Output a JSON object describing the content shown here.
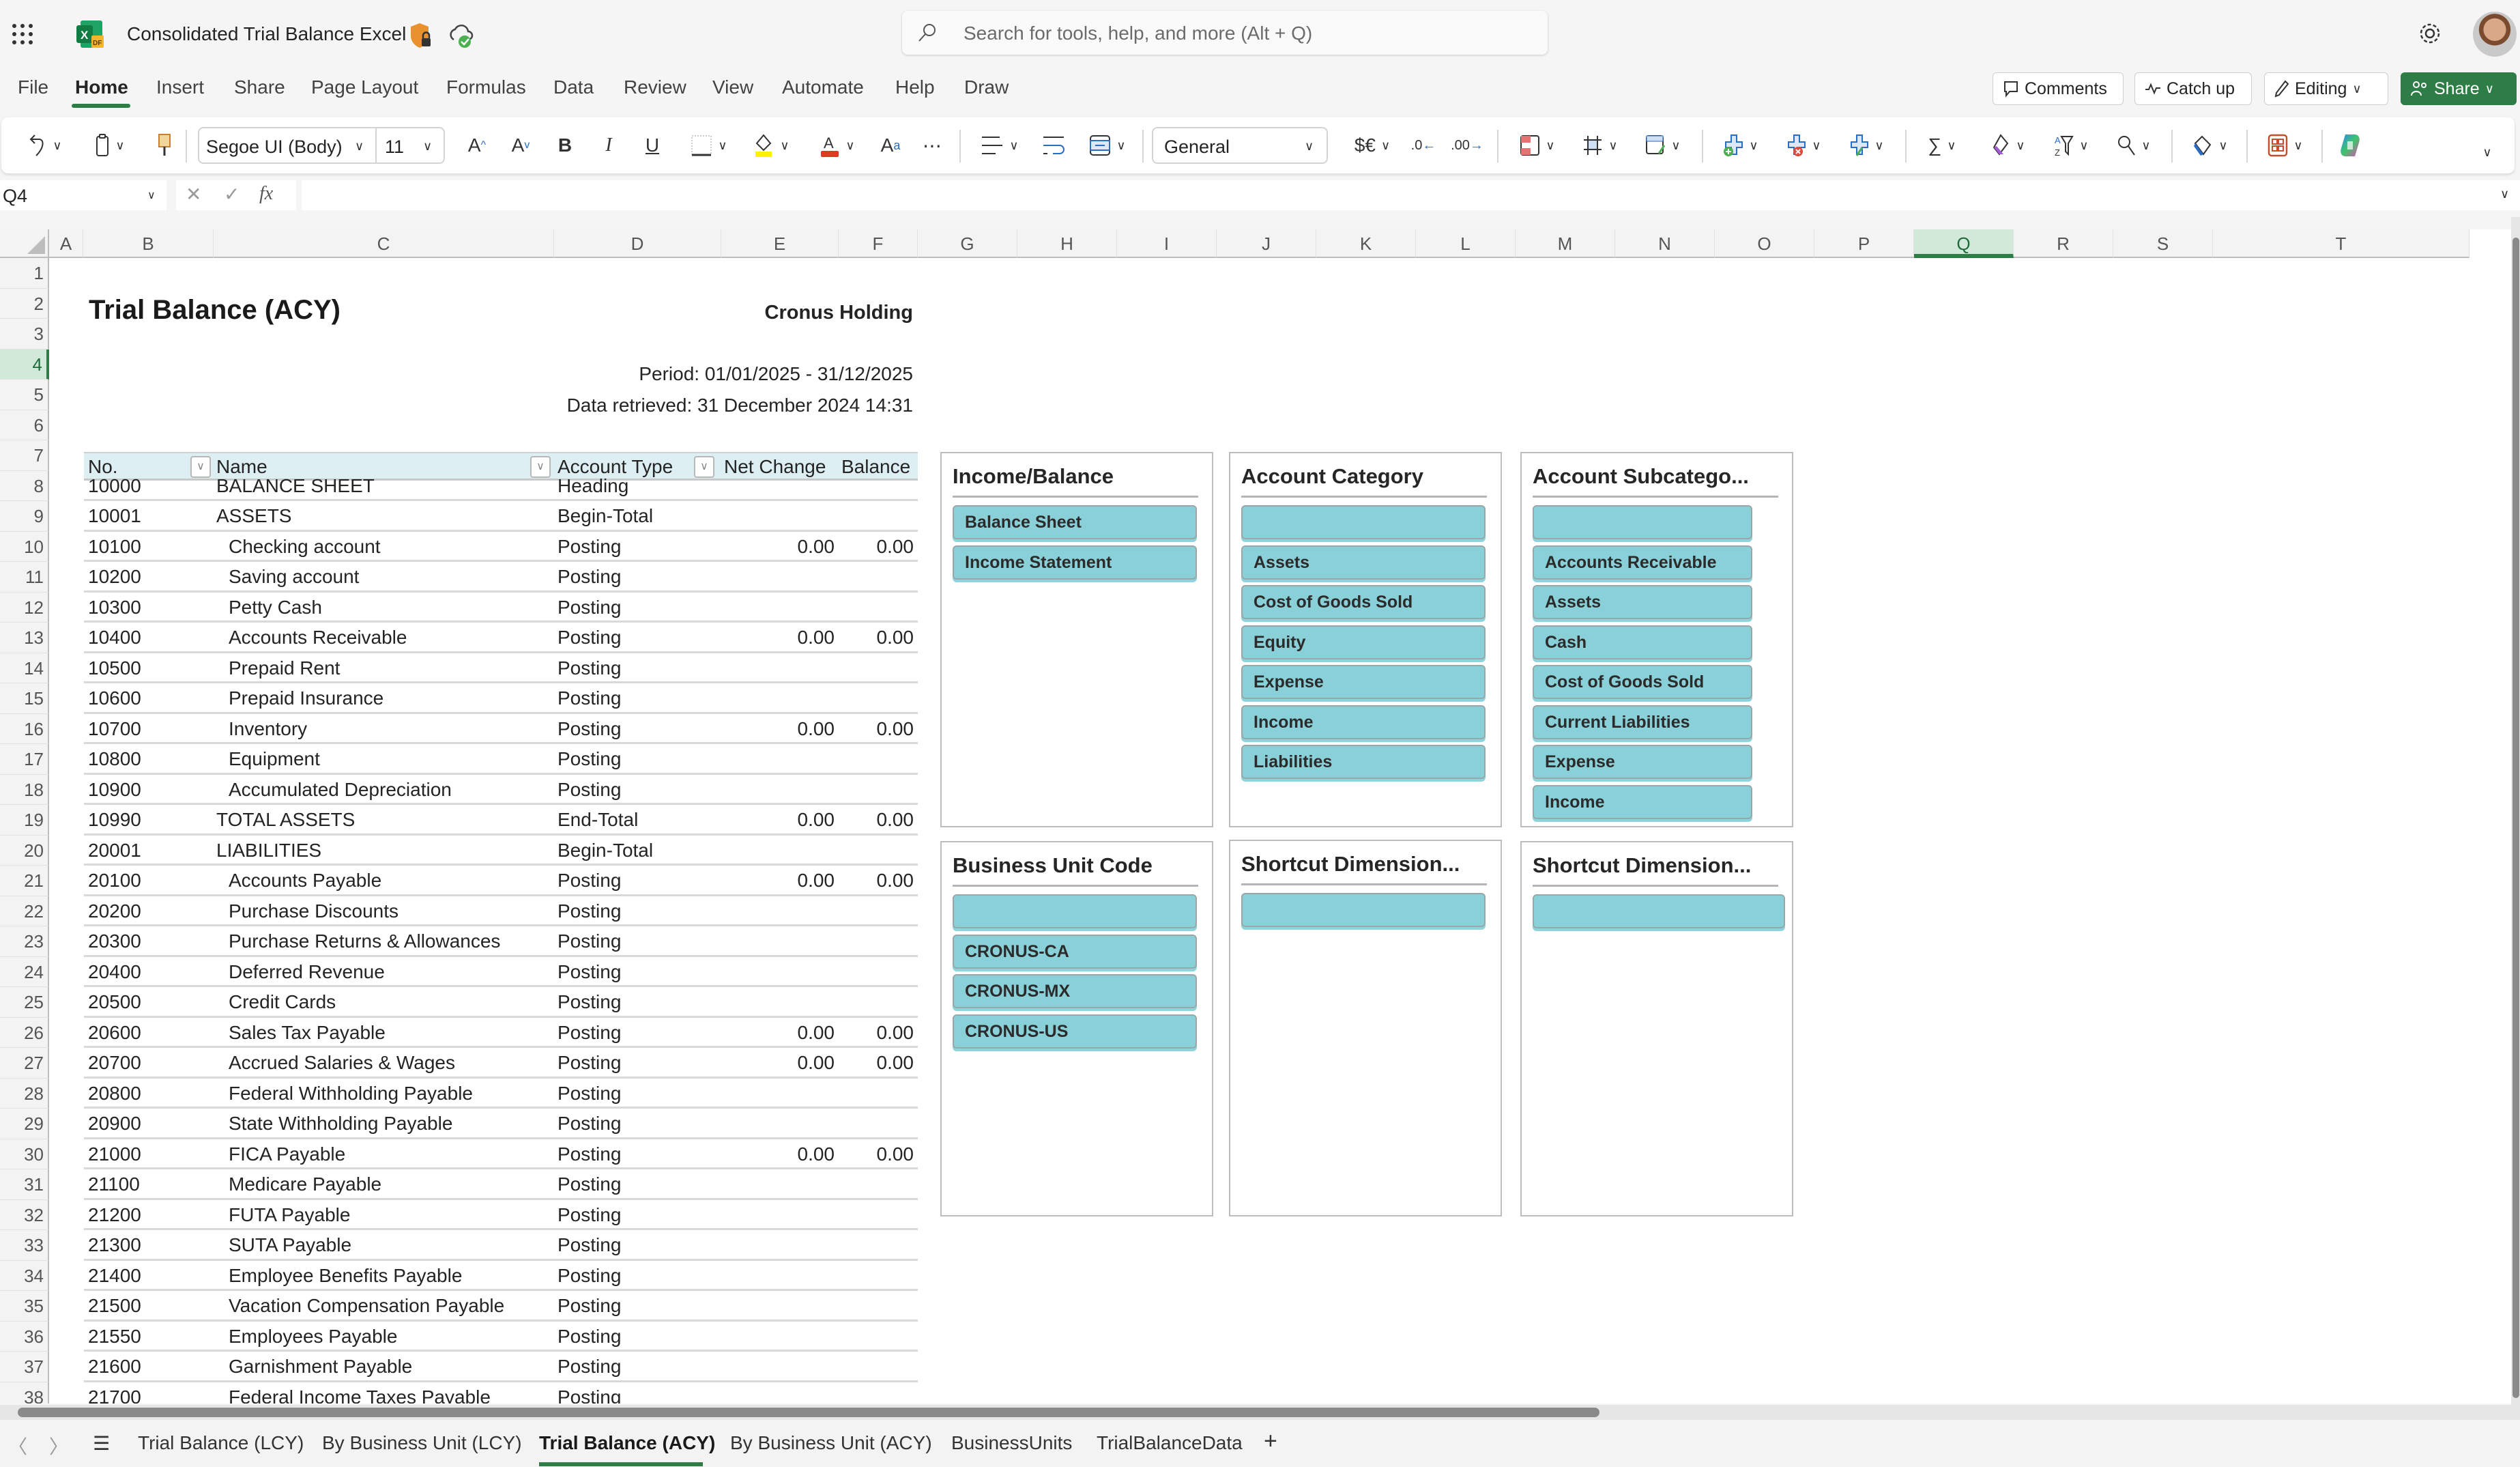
{
  "app": {
    "title": "Consolidated Trial Balance Excel",
    "search_placeholder": "Search for tools, help, and more (Alt + Q)"
  },
  "menu": {
    "tabs": [
      "File",
      "Home",
      "Insert",
      "Share",
      "Page Layout",
      "Formulas",
      "Data",
      "Review",
      "View",
      "Automate",
      "Help",
      "Draw"
    ],
    "active": "Home",
    "buttons": {
      "comments": "Comments",
      "catch_up": "Catch up",
      "editing": "Editing",
      "share": "Share"
    }
  },
  "ribbon": {
    "font_name": "Segoe UI (Body)",
    "font_size": "11",
    "number_format": "General",
    "currency_label": "$€"
  },
  "formula_bar": {
    "name_box": "Q4",
    "formula": ""
  },
  "grid": {
    "columns": [
      "A",
      "B",
      "C",
      "D",
      "E",
      "F",
      "G",
      "H",
      "I",
      "J",
      "K",
      "L",
      "M",
      "N",
      "O",
      "P",
      "Q",
      "R",
      "S",
      "T"
    ],
    "selected_column": "Q",
    "selected_row": 4,
    "rows": [
      "1",
      "2",
      "3",
      "4",
      "5",
      "6",
      "7",
      "8",
      "9",
      "10",
      "11",
      "12",
      "13",
      "14",
      "15",
      "16",
      "17",
      "18",
      "19",
      "20",
      "21",
      "22",
      "23",
      "24",
      "25",
      "26",
      "27",
      "28",
      "29",
      "30",
      "31",
      "32",
      "33",
      "34",
      "35",
      "36",
      "37",
      "38"
    ]
  },
  "report": {
    "title": "Trial Balance (ACY)",
    "company": "Cronus Holding",
    "period": "Period: 01/01/2025 - 31/12/2025",
    "retrieved": "Data retrieved: 31 December 2024 14:31",
    "headers": {
      "no": "No.",
      "name": "Name",
      "account_type": "Account Type",
      "net_change": "Net Change",
      "balance": "Balance"
    },
    "rows": [
      {
        "no": "10000",
        "name": "BALANCE SHEET",
        "type": "Heading",
        "net": "",
        "bal": "",
        "indent": 0
      },
      {
        "no": "10001",
        "name": "ASSETS",
        "type": "Begin-Total",
        "net": "",
        "bal": "",
        "indent": 0
      },
      {
        "no": "10100",
        "name": "Checking account",
        "type": "Posting",
        "net": "0.00",
        "bal": "0.00",
        "indent": 1
      },
      {
        "no": "10200",
        "name": "Saving account",
        "type": "Posting",
        "net": "",
        "bal": "",
        "indent": 1
      },
      {
        "no": "10300",
        "name": "Petty Cash",
        "type": "Posting",
        "net": "",
        "bal": "",
        "indent": 1
      },
      {
        "no": "10400",
        "name": "Accounts Receivable",
        "type": "Posting",
        "net": "0.00",
        "bal": "0.00",
        "indent": 1
      },
      {
        "no": "10500",
        "name": "Prepaid Rent",
        "type": "Posting",
        "net": "",
        "bal": "",
        "indent": 1
      },
      {
        "no": "10600",
        "name": "Prepaid Insurance",
        "type": "Posting",
        "net": "",
        "bal": "",
        "indent": 1
      },
      {
        "no": "10700",
        "name": "Inventory",
        "type": "Posting",
        "net": "0.00",
        "bal": "0.00",
        "indent": 1
      },
      {
        "no": "10800",
        "name": "Equipment",
        "type": "Posting",
        "net": "",
        "bal": "",
        "indent": 1
      },
      {
        "no": "10900",
        "name": "Accumulated Depreciation",
        "type": "Posting",
        "net": "",
        "bal": "",
        "indent": 1
      },
      {
        "no": "10990",
        "name": "TOTAL ASSETS",
        "type": "End-Total",
        "net": "0.00",
        "bal": "0.00",
        "indent": 0
      },
      {
        "no": "20001",
        "name": "LIABILITIES",
        "type": "Begin-Total",
        "net": "",
        "bal": "",
        "indent": 0
      },
      {
        "no": "20100",
        "name": "Accounts Payable",
        "type": "Posting",
        "net": "0.00",
        "bal": "0.00",
        "indent": 1
      },
      {
        "no": "20200",
        "name": "Purchase Discounts",
        "type": "Posting",
        "net": "",
        "bal": "",
        "indent": 1
      },
      {
        "no": "20300",
        "name": "Purchase Returns & Allowances",
        "type": "Posting",
        "net": "",
        "bal": "",
        "indent": 1
      },
      {
        "no": "20400",
        "name": "Deferred Revenue",
        "type": "Posting",
        "net": "",
        "bal": "",
        "indent": 1
      },
      {
        "no": "20500",
        "name": "Credit Cards",
        "type": "Posting",
        "net": "",
        "bal": "",
        "indent": 1
      },
      {
        "no": "20600",
        "name": "Sales Tax Payable",
        "type": "Posting",
        "net": "0.00",
        "bal": "0.00",
        "indent": 1
      },
      {
        "no": "20700",
        "name": "Accrued Salaries & Wages",
        "type": "Posting",
        "net": "0.00",
        "bal": "0.00",
        "indent": 1
      },
      {
        "no": "20800",
        "name": "Federal Withholding Payable",
        "type": "Posting",
        "net": "",
        "bal": "",
        "indent": 1
      },
      {
        "no": "20900",
        "name": "State Withholding Payable",
        "type": "Posting",
        "net": "",
        "bal": "",
        "indent": 1
      },
      {
        "no": "21000",
        "name": "FICA Payable",
        "type": "Posting",
        "net": "0.00",
        "bal": "0.00",
        "indent": 1
      },
      {
        "no": "21100",
        "name": "Medicare Payable",
        "type": "Posting",
        "net": "",
        "bal": "",
        "indent": 1
      },
      {
        "no": "21200",
        "name": "FUTA Payable",
        "type": "Posting",
        "net": "",
        "bal": "",
        "indent": 1
      },
      {
        "no": "21300",
        "name": "SUTA Payable",
        "type": "Posting",
        "net": "",
        "bal": "",
        "indent": 1
      },
      {
        "no": "21400",
        "name": "Employee Benefits Payable",
        "type": "Posting",
        "net": "",
        "bal": "",
        "indent": 1
      },
      {
        "no": "21500",
        "name": "Vacation Compensation Payable",
        "type": "Posting",
        "net": "",
        "bal": "",
        "indent": 1
      },
      {
        "no": "21550",
        "name": "Employees Payable",
        "type": "Posting",
        "net": "",
        "bal": "",
        "indent": 1
      },
      {
        "no": "21600",
        "name": "Garnishment Payable",
        "type": "Posting",
        "net": "",
        "bal": "",
        "indent": 1
      },
      {
        "no": "21700",
        "name": "Federal Income Taxes Payable",
        "type": "Posting",
        "net": "",
        "bal": "",
        "indent": 1
      }
    ]
  },
  "slicers": [
    {
      "title": "Income/Balance",
      "items": [
        "Balance Sheet",
        "Income Statement"
      ]
    },
    {
      "title": "Account Category",
      "items": [
        "",
        "Assets",
        "Cost of Goods Sold",
        "Equity",
        "Expense",
        "Income",
        "Liabilities"
      ]
    },
    {
      "title": "Account Subcatego...",
      "items": [
        "",
        "Accounts Receivable",
        "Assets",
        "Cash",
        "Cost of Goods Sold",
        "Current Liabilities",
        "Expense",
        "Income"
      ]
    },
    {
      "title": "Business Unit Code",
      "items": [
        "",
        "CRONUS-CA",
        "CRONUS-MX",
        "CRONUS-US"
      ]
    },
    {
      "title": "Shortcut Dimension...",
      "items": [
        ""
      ]
    },
    {
      "title": "Shortcut Dimension...",
      "items": [
        ""
      ]
    }
  ],
  "sheets": {
    "tabs": [
      "Trial Balance (LCY)",
      "By Business Unit (LCY)",
      "Trial Balance (ACY)",
      "By Business Unit (ACY)",
      "BusinessUnits",
      "TrialBalanceData"
    ],
    "active": "Trial Balance (ACY)",
    "add_label": "+"
  },
  "colors": {
    "accent": "#2e7d46",
    "slicer_item": "#8ad0d8",
    "table_header": "#ddeff3"
  }
}
